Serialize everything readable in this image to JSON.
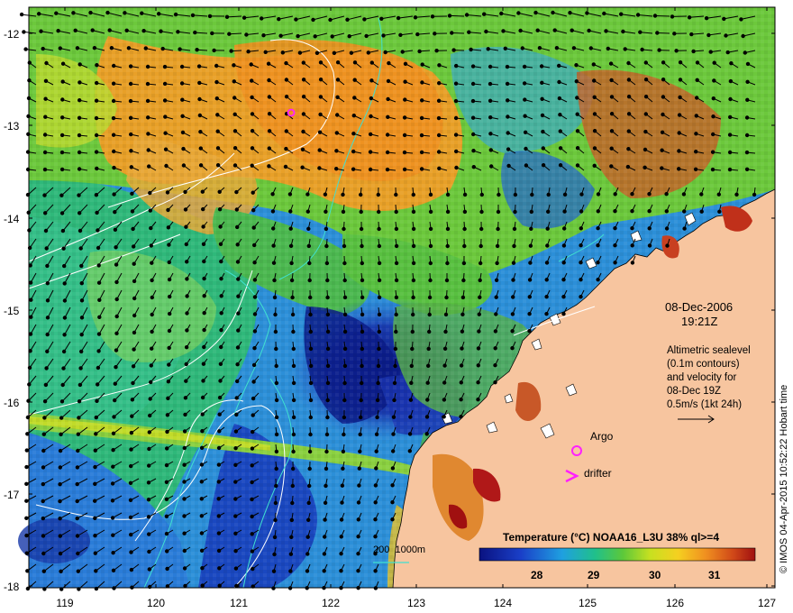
{
  "map": {
    "y_ticks": [
      "-12",
      "-13",
      "-14",
      "-15",
      "-16",
      "-17",
      "-18"
    ],
    "x_ticks": [
      "119",
      "120",
      "121",
      "122",
      "123",
      "124",
      "125",
      "126",
      "127"
    ],
    "date": "08-Dec-2006",
    "time": "19:21Z",
    "info_lines": [
      "Altimetric sealevel",
      "(0.1m contours)",
      "and velocity for",
      "08-Dec 19Z",
      "0.5m/s (1kt 24h)"
    ],
    "argo_label": "Argo",
    "drifter_label": "drifter",
    "depth_label": "200  1000m",
    "colorbar": {
      "title": "Temperature (°C) NOAA16_L3U 38% ql>=4",
      "ticks": [
        "28",
        "29",
        "30",
        "31"
      ]
    },
    "credit": "© IMOS 04-Apr-2015 10:52:22 Hobart time",
    "colors": {
      "land": "#f7c59f",
      "ocean_warm": "#e8961c",
      "ocean_mid": "#3fae3f",
      "ocean_cool": "#1f5fd0",
      "ocean_deep": "#0a1f8c",
      "argo": "#ff20ff",
      "contour": "#ffffff",
      "isobath": "#40e0d0"
    }
  }
}
